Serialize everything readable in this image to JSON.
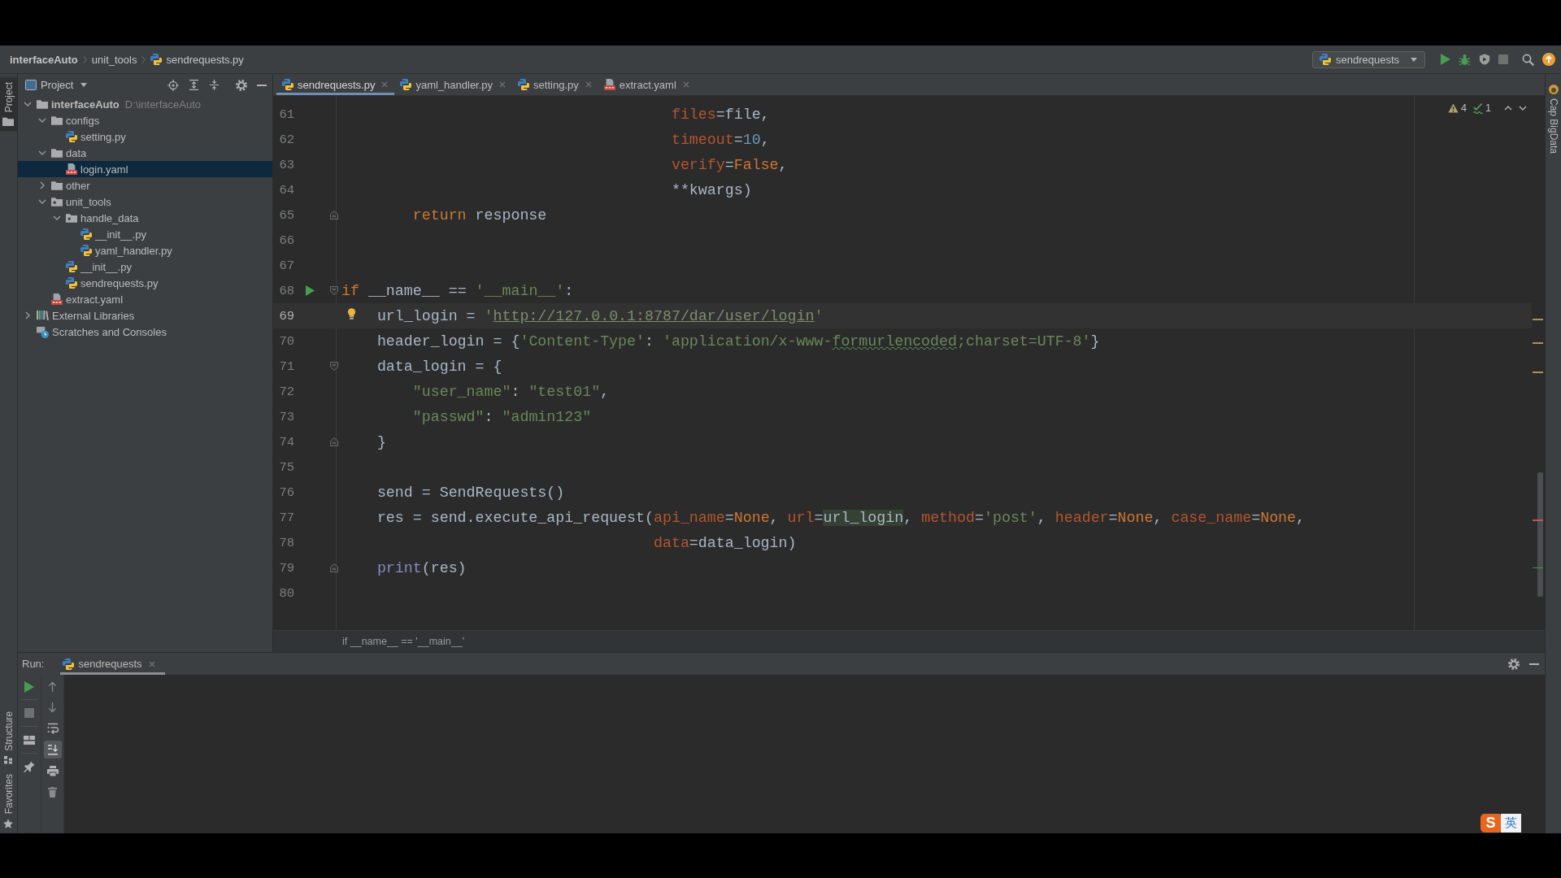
{
  "navigation_bar": {
    "breadcrumbs": [
      {
        "label": "interfaceAuto",
        "kind": "project"
      },
      {
        "label": "unit_tools",
        "kind": "folder"
      },
      {
        "label": "sendrequests.py",
        "kind": "python"
      }
    ],
    "run_configuration": {
      "label": "sendrequests",
      "kind": "python"
    },
    "actions": [
      {
        "kind": "run",
        "disabled": false
      },
      {
        "kind": "debug",
        "disabled": false
      },
      {
        "kind": "coverage",
        "disabled": true
      },
      {
        "kind": "stop",
        "disabled": true
      },
      {
        "kind": "search",
        "disabled": false
      },
      {
        "kind": "update",
        "disabled": false
      }
    ]
  },
  "left_stripe": {
    "top": [
      {
        "label": "Project",
        "kind": "project",
        "selected": true
      }
    ],
    "bottom": [
      {
        "label": "Structure",
        "kind": "structure",
        "selected": false
      },
      {
        "label": "Favorites",
        "kind": "favorites",
        "selected": false
      }
    ]
  },
  "project_panel": {
    "title": "Project",
    "tree": [
      {
        "label": "interfaceAuto",
        "kind": "project",
        "hint": "D:\\interfaceAuto",
        "expanded": true,
        "selected": false,
        "children": [
          {
            "label": "configs",
            "kind": "folder",
            "expanded": true,
            "selected": false,
            "children": [
              {
                "label": "setting.py",
                "kind": "python",
                "selected": false
              }
            ]
          },
          {
            "label": "data",
            "kind": "folder",
            "expanded": true,
            "selected": false,
            "children": [
              {
                "label": "login.yaml",
                "kind": "yaml",
                "selected": true
              }
            ]
          },
          {
            "label": "other",
            "kind": "folder",
            "expanded": false,
            "selected": false
          },
          {
            "label": "unit_tools",
            "kind": "package",
            "expanded": true,
            "selected": false,
            "children": [
              {
                "label": "handle_data",
                "kind": "package",
                "expanded": true,
                "selected": false,
                "children": [
                  {
                    "label": "__init__.py",
                    "kind": "python",
                    "selected": false
                  },
                  {
                    "label": "yaml_handler.py",
                    "kind": "python",
                    "selected": false
                  }
                ]
              },
              {
                "label": "__init__.py",
                "kind": "python",
                "selected": false
              },
              {
                "label": "sendrequests.py",
                "kind": "python",
                "selected": false
              }
            ]
          },
          {
            "label": "extract.yaml",
            "kind": "yaml",
            "selected": false
          }
        ]
      },
      {
        "label": "External Libraries",
        "kind": "libraries",
        "expanded": false,
        "selected": false
      },
      {
        "label": "Scratches and Consoles",
        "kind": "scratches",
        "selected": false
      }
    ]
  },
  "editor": {
    "tabs": [
      {
        "label": "sendrequests.py",
        "kind": "python",
        "selected": true
      },
      {
        "label": "yaml_handler.py",
        "kind": "python",
        "selected": false
      },
      {
        "label": "setting.py",
        "kind": "python",
        "selected": false
      },
      {
        "label": "extract.yaml",
        "kind": "yaml",
        "selected": false
      }
    ],
    "inspections": {
      "warnings": "4",
      "typos": "1"
    },
    "lines": [
      {
        "number": "61",
        "current": false,
        "tokens": [
          {
            "kind": "param",
            "text": "                                     files"
          },
          {
            "kind": "plain",
            "text": "=file,"
          }
        ]
      },
      {
        "number": "62",
        "current": false,
        "tokens": [
          {
            "kind": "param",
            "text": "                                     timeout"
          },
          {
            "kind": "plain",
            "text": "="
          },
          {
            "kind": "number",
            "text": "10"
          },
          {
            "kind": "plain",
            "text": ","
          }
        ]
      },
      {
        "number": "63",
        "current": false,
        "tokens": [
          {
            "kind": "param",
            "text": "                                     verify"
          },
          {
            "kind": "plain",
            "text": "="
          },
          {
            "kind": "keyword",
            "text": "False"
          },
          {
            "kind": "plain",
            "text": ","
          }
        ]
      },
      {
        "number": "64",
        "current": false,
        "tokens": [
          {
            "kind": "plain",
            "text": "                                     **kwargs)"
          }
        ]
      },
      {
        "number": "65",
        "current": false,
        "fold": {
          "kind": "end"
        },
        "tokens": [
          {
            "kind": "keyword",
            "text": "        return"
          },
          {
            "kind": "plain",
            "text": " response"
          }
        ]
      },
      {
        "number": "66",
        "current": false
      },
      {
        "number": "67",
        "current": false
      },
      {
        "number": "68",
        "current": false,
        "marker": {
          "kind": "run"
        },
        "fold": {
          "kind": "start"
        },
        "tokens": [
          {
            "kind": "keyword",
            "text": "if"
          },
          {
            "kind": "plain",
            "text": " __name__ == "
          },
          {
            "kind": "string",
            "text": "'__main__'"
          },
          {
            "kind": "plain",
            "text": ":"
          }
        ]
      },
      {
        "number": "69",
        "current": true,
        "marker": {
          "kind": "bulb"
        },
        "tokens": [
          {
            "kind": "plain",
            "text": "    url_login = "
          },
          {
            "kind": "string",
            "text": "'"
          },
          {
            "kind": "link",
            "text": "http://127.0.0.1:8787/dar/user/login"
          },
          {
            "kind": "string",
            "text": "'"
          }
        ]
      },
      {
        "number": "70",
        "current": false,
        "tokens": [
          {
            "kind": "plain",
            "text": "    header_login = {"
          },
          {
            "kind": "string",
            "text": "'Content-Type'"
          },
          {
            "kind": "plain",
            "text": ": "
          },
          {
            "kind": "string",
            "text": "'application/x-www-"
          },
          {
            "kind": "typo",
            "text": "formurlencoded"
          },
          {
            "kind": "string",
            "text": ";charset=UTF-8'"
          },
          {
            "kind": "plain",
            "text": "}"
          }
        ]
      },
      {
        "number": "71",
        "current": false,
        "fold": {
          "kind": "start"
        },
        "tokens": [
          {
            "kind": "plain",
            "text": "    data_login = {"
          }
        ]
      },
      {
        "number": "72",
        "current": false,
        "tokens": [
          {
            "kind": "string",
            "text": "        \"user_name\""
          },
          {
            "kind": "plain",
            "text": ": "
          },
          {
            "kind": "string",
            "text": "\"test01\""
          },
          {
            "kind": "plain",
            "text": ","
          }
        ]
      },
      {
        "number": "73",
        "current": false,
        "tokens": [
          {
            "kind": "string",
            "text": "        \"passwd\""
          },
          {
            "kind": "plain",
            "text": ": "
          },
          {
            "kind": "string",
            "text": "\"admin123\""
          }
        ]
      },
      {
        "number": "74",
        "current": false,
        "fold": {
          "kind": "end"
        },
        "tokens": [
          {
            "kind": "plain",
            "text": "    }"
          }
        ]
      },
      {
        "number": "75",
        "current": false
      },
      {
        "number": "76",
        "current": false,
        "tokens": [
          {
            "kind": "plain",
            "text": "    send = SendRequests()"
          }
        ]
      },
      {
        "number": "77",
        "current": false,
        "tokens": [
          {
            "kind": "plain",
            "text": "    res = send.execute_api_request("
          },
          {
            "kind": "param",
            "text": "api_name"
          },
          {
            "kind": "plain",
            "text": "="
          },
          {
            "kind": "keyword",
            "text": "None"
          },
          {
            "kind": "plain",
            "text": ", "
          },
          {
            "kind": "param",
            "text": "url"
          },
          {
            "kind": "plain",
            "text": "="
          },
          {
            "kind": "usage",
            "text": "url_login"
          },
          {
            "kind": "plain",
            "text": ", "
          },
          {
            "kind": "param",
            "text": "method"
          },
          {
            "kind": "plain",
            "text": "="
          },
          {
            "kind": "string",
            "text": "'post'"
          },
          {
            "kind": "plain",
            "text": ", "
          },
          {
            "kind": "param",
            "text": "header"
          },
          {
            "kind": "plain",
            "text": "="
          },
          {
            "kind": "keyword",
            "text": "None"
          },
          {
            "kind": "plain",
            "text": ", "
          },
          {
            "kind": "param",
            "text": "case_name"
          },
          {
            "kind": "plain",
            "text": "="
          },
          {
            "kind": "keyword",
            "text": "None"
          },
          {
            "kind": "plain",
            "text": ","
          }
        ]
      },
      {
        "number": "78",
        "current": false,
        "tokens": [
          {
            "kind": "param",
            "text": "                                   data"
          },
          {
            "kind": "plain",
            "text": "=data_login)"
          }
        ]
      },
      {
        "number": "79",
        "current": false,
        "fold": {
          "kind": "end"
        },
        "tokens": [
          {
            "kind": "builtin",
            "text": "    print"
          },
          {
            "kind": "plain",
            "text": "(res)"
          }
        ]
      },
      {
        "number": "80",
        "current": false
      }
    ],
    "breadcrumb": "if __name__ == '__main__'"
  },
  "right_stripe": [
    {
      "label": "Cap BigData"
    }
  ],
  "run_panel": {
    "label": "Run:",
    "tabs": [
      {
        "label": "sendrequests",
        "kind": "python",
        "selected": true
      }
    ],
    "main_actions": [
      {
        "kind": "run",
        "disabled": false
      },
      {
        "kind": "stop",
        "disabled": true
      },
      {
        "kind": "layout",
        "disabled": false
      },
      {
        "kind": "pin",
        "disabled": false
      }
    ],
    "console_actions": [
      {
        "kind": "up",
        "disabled": true
      },
      {
        "kind": "down",
        "disabled": true
      },
      {
        "kind": "soft_wrap",
        "disabled": false,
        "on": false
      },
      {
        "kind": "scroll_to_end",
        "disabled": false,
        "on": true
      },
      {
        "kind": "print",
        "disabled": false
      },
      {
        "kind": "clear",
        "disabled": true
      }
    ]
  },
  "ime_indicator": {
    "logo": "S",
    "mode": "英"
  }
}
